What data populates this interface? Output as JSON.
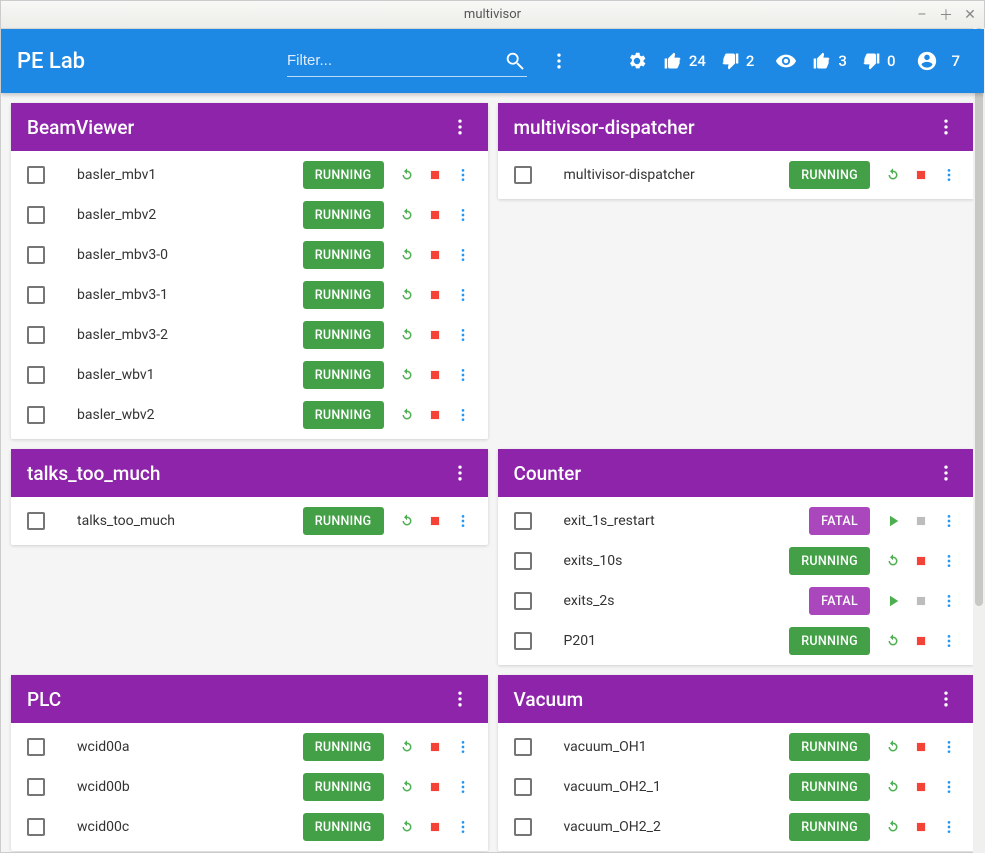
{
  "window": {
    "title": "multivisor"
  },
  "toolbar": {
    "title": "PE Lab",
    "search_placeholder": "Filter...",
    "stats": {
      "running": "24",
      "stopped_a": "2",
      "watching": "3",
      "stopped_b": "0",
      "supervisors": "7"
    }
  },
  "groups": [
    {
      "id": "beamviewer",
      "title": "BeamViewer",
      "processes": [
        {
          "name": "basler_mbv1",
          "status": "RUNNING"
        },
        {
          "name": "basler_mbv2",
          "status": "RUNNING"
        },
        {
          "name": "basler_mbv3-0",
          "status": "RUNNING"
        },
        {
          "name": "basler_mbv3-1",
          "status": "RUNNING"
        },
        {
          "name": "basler_mbv3-2",
          "status": "RUNNING"
        },
        {
          "name": "basler_wbv1",
          "status": "RUNNING"
        },
        {
          "name": "basler_wbv2",
          "status": "RUNNING"
        }
      ]
    },
    {
      "id": "multivisor-dispatcher",
      "title": "multivisor-dispatcher",
      "processes": [
        {
          "name": "multivisor-dispatcher",
          "status": "RUNNING"
        }
      ]
    },
    {
      "id": "talks-too-much",
      "title": "talks_too_much",
      "processes": [
        {
          "name": "talks_too_much",
          "status": "RUNNING"
        }
      ]
    },
    {
      "id": "counter",
      "title": "Counter",
      "processes": [
        {
          "name": "exit_1s_restart",
          "status": "FATAL"
        },
        {
          "name": "exits_10s",
          "status": "RUNNING"
        },
        {
          "name": "exits_2s",
          "status": "FATAL"
        },
        {
          "name": "P201",
          "status": "RUNNING"
        }
      ]
    },
    {
      "id": "plc",
      "title": "PLC",
      "processes": [
        {
          "name": "wcid00a",
          "status": "RUNNING"
        },
        {
          "name": "wcid00b",
          "status": "RUNNING"
        },
        {
          "name": "wcid00c",
          "status": "RUNNING"
        }
      ]
    },
    {
      "id": "vacuum",
      "title": "Vacuum",
      "processes": [
        {
          "name": "vacuum_OH1",
          "status": "RUNNING"
        },
        {
          "name": "vacuum_OH2_1",
          "status": "RUNNING"
        },
        {
          "name": "vacuum_OH2_2",
          "status": "RUNNING"
        }
      ]
    }
  ]
}
